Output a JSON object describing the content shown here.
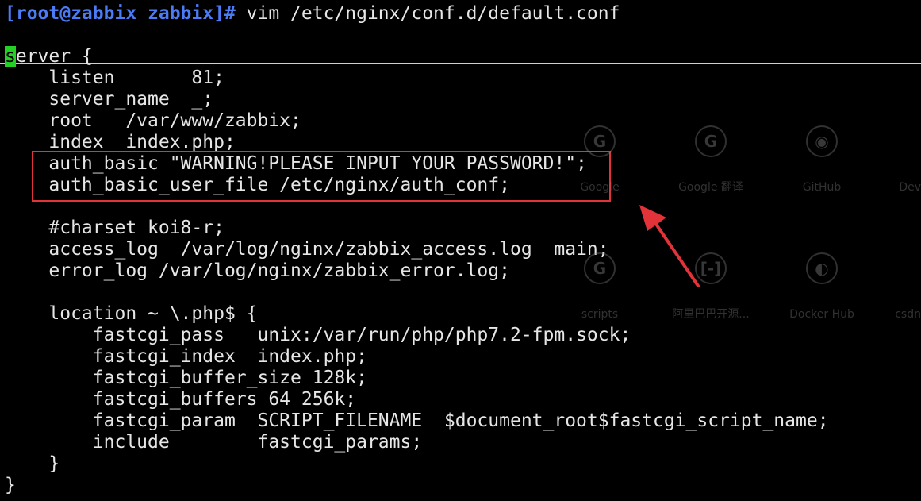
{
  "prompt": {
    "user_host": "[root@zabbix zabbix]#",
    "command": " vim /etc/nginx/conf.d/default.conf"
  },
  "editor": {
    "cursor_char": "s",
    "first_line_rest": "erver {",
    "lines": [
      "    listen       81;",
      "    server_name  _;",
      "    root   /var/www/zabbix;",
      "    index  index.php;",
      "    auth_basic \"WARNING!PLEASE INPUT YOUR PASSWORD!\";",
      "    auth_basic_user_file /etc/nginx/auth_conf;",
      "",
      "    #charset koi8-r;",
      "    access_log  /var/log/nginx/zabbix_access.log  main;",
      "    error_log /var/log/nginx/zabbix_error.log;",
      "",
      "    location ~ \\.php$ {",
      "        fastcgi_pass   unix:/var/run/php/php7.2-fpm.sock;",
      "        fastcgi_index  index.php;",
      "        fastcgi_buffer_size 128k;",
      "        fastcgi_buffers 64 256k;",
      "        fastcgi_param  SCRIPT_FILENAME  $document_root$fastcgi_script_name;",
      "        include        fastcgi_params;",
      "    }",
      "}"
    ]
  },
  "overlay_shortcuts": [
    {
      "label": "Google",
      "icon": "G"
    },
    {
      "label": "Google 翻译",
      "icon": "G"
    },
    {
      "label": "GitHub",
      "icon": "◉"
    },
    {
      "label": "Dev",
      "icon": ""
    },
    {
      "label": "scripts",
      "icon": "G"
    },
    {
      "label": "阿里巴巴开源...",
      "icon": "[-]"
    },
    {
      "label": "Docker Hub",
      "icon": "◐"
    },
    {
      "label": "csdn",
      "icon": ""
    }
  ],
  "colors": {
    "background": "#000000",
    "text": "#e6e6e6",
    "prompt": "#4b7bf5",
    "cursor": "#24d024",
    "highlight": "#e2323a"
  }
}
